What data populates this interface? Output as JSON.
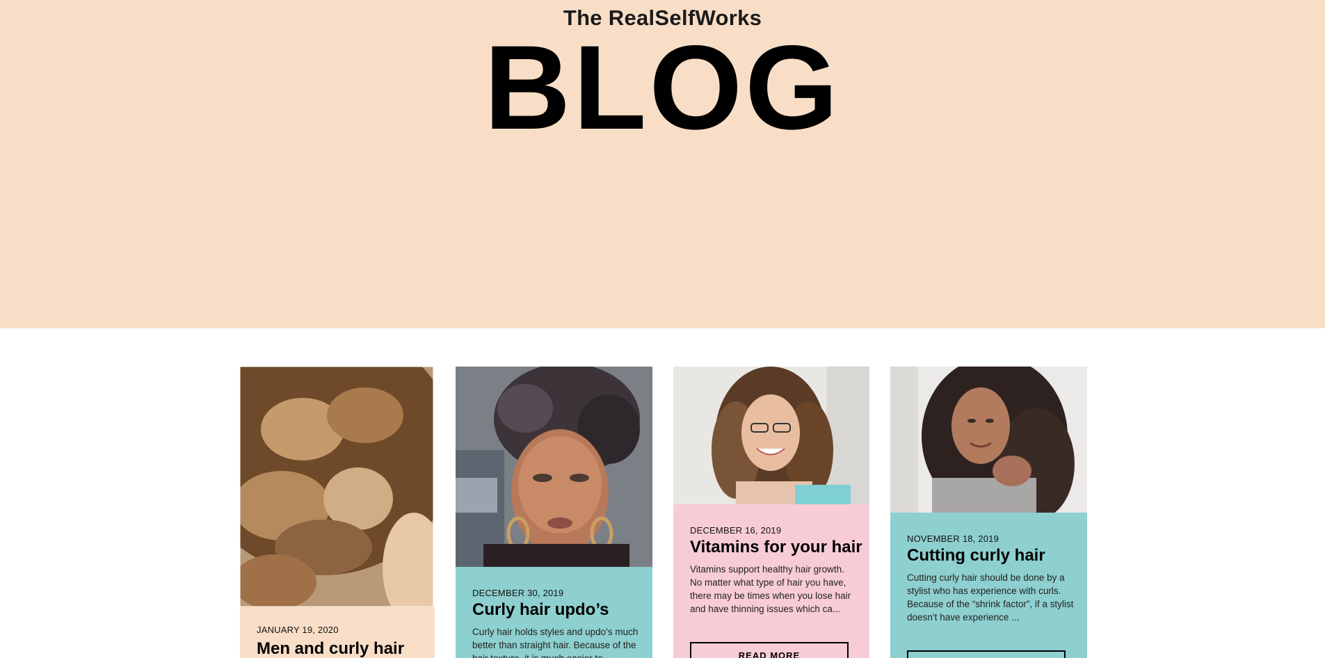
{
  "brand": "The RealSelfWorks",
  "page_title": "BLOG",
  "colors": {
    "hero_bg": "#f8dec6",
    "peach_card": "#f8dec6",
    "teal_card": "#8ecfcf",
    "pink_card": "#f8ccd7"
  },
  "posts": [
    {
      "date": "JANUARY 19, 2020",
      "title": "Men and curly hair",
      "excerpt": "",
      "read_more": ""
    },
    {
      "date": "DECEMBER 30, 2019",
      "title": "Curly hair updo’s",
      "excerpt": "Curly hair holds styles and updo’s much better than straight hair. Because of the hair texture, it is much easier to",
      "read_more": ""
    },
    {
      "date": "DECEMBER 16, 2019",
      "title": "Vitamins for your hair",
      "excerpt": "Vitamins support healthy hair growth. No matter what type of hair you have, there may be times when you lose hair and have thinning issues which ca...",
      "read_more": "READ MORE"
    },
    {
      "date": "NOVEMBER 18, 2019",
      "title": "Cutting curly hair",
      "excerpt": "Cutting curly hair should be done by a stylist who has experience with curls. Because of the “shrink factor”, if a stylist doesn’t have experience ...",
      "read_more": ""
    }
  ]
}
